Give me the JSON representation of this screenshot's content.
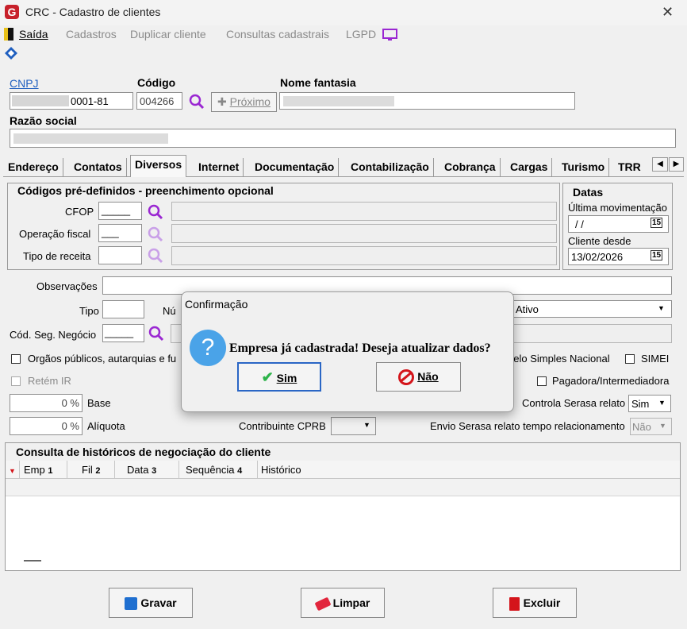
{
  "window": {
    "title": "CRC - Cadastro de clientes",
    "logo_letter": "G",
    "close_glyph": "✕"
  },
  "menu": {
    "saida": "Saída",
    "cadastros": "Cadastros",
    "duplicar": "Duplicar cliente",
    "consultas": "Consultas cadastrais",
    "lgpd": "LGPD"
  },
  "header": {
    "cnpj_label": "CNPJ",
    "cnpj_value": "0001-81",
    "codigo_label": "Código",
    "codigo_value": "004266",
    "proximo_label": "Próximo",
    "nome_fantasia_label": "Nome fantasia",
    "razao_social_label": "Razão social"
  },
  "tabs": [
    "Endereço",
    "Contatos",
    "Diversos",
    "Internet",
    "Documentação",
    "Contabilização",
    "Cobrança",
    "Cargas",
    "Turismo",
    "TRR"
  ],
  "codigos": {
    "title": "Códigos pré-definidos - preenchimento opcional",
    "cfop_label": "CFOP",
    "cfop_value": "_____",
    "operacao_label": "Operação fiscal",
    "operacao_value": "___",
    "receita_label": "Tipo de receita"
  },
  "datas": {
    "title": "Datas",
    "ultima_label": "Última movimentação",
    "ultima_value": " / /",
    "cliente_desde_label": "Cliente desde",
    "cliente_desde_value": "13/02/2026",
    "cal_glyph": "15"
  },
  "diversos": {
    "observacoes_label": "Observações",
    "tipo_label": "Tipo",
    "numero_label": "Nú",
    "status_value": "Ativo",
    "cod_seg_label": "Cód. Seg. Negócio",
    "cod_seg_value": "_____",
    "orgaos_label": "Orgãos públicos, autarquias e fu",
    "simples_label": "pelo Simples Nacional",
    "simei_label": "SIMEI",
    "retem_label": "Retém IR",
    "pagadora_label": "Pagadora/Intermediadora",
    "base_label": "Base",
    "base_value": "0 %",
    "aliquota_label": "Alíquota",
    "aliquota_value": "0 %",
    "serasa_label": "Controla Serasa relato",
    "serasa_value": "Sim",
    "cprb_label": "Contribuinte CPRB",
    "envio_label": "Envio Serasa relato tempo relacionamento",
    "envio_value": "Não"
  },
  "historico": {
    "title": "Consulta de históricos de negociação do cliente",
    "columns": [
      {
        "label": "Emp",
        "num": "1"
      },
      {
        "label": "Fil",
        "num": "2"
      },
      {
        "label": "Data",
        "num": "3"
      },
      {
        "label": "Sequência",
        "num": "4"
      },
      {
        "label": "Histórico",
        "num": ""
      }
    ]
  },
  "footer": {
    "gravar": "Gravar",
    "limpar": "Limpar",
    "excluir": "Excluir"
  },
  "dialog": {
    "title": "Confirmação",
    "message": "Empresa já cadastrada! Deseja atualizar dados?",
    "icon_glyph": "?",
    "sim": "Sim",
    "nao": "Não"
  },
  "colors": {
    "accent_blue": "#1f5fbf",
    "dialog_icon": "#4aa3e8",
    "danger": "#d4151b",
    "purple_icon": "#9a27d2"
  }
}
